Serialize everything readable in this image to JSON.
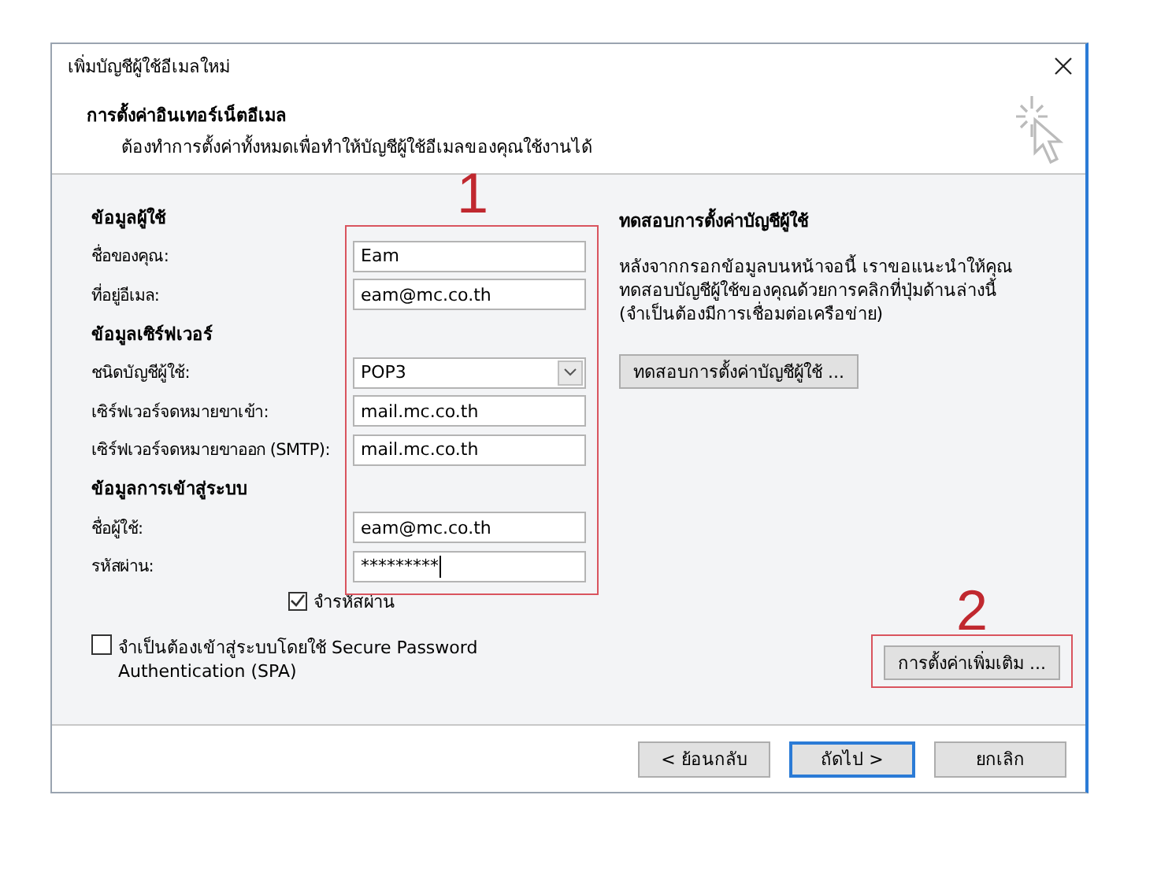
{
  "window": {
    "title": "เพิ่มบัญชีผู้ใช้อีเมลใหม่"
  },
  "header": {
    "title": "การตั้งค่าอินเทอร์เน็ตอีเมล",
    "subtitle": "ต้องทำการตั้งค่าทั้งหมดเพื่อทำให้บัญชีผู้ใช้อีเมลของคุณใช้งานได้"
  },
  "sections": [
    {
      "heading": "ข้อมูลผู้ใช้",
      "fields": [
        {
          "label": "ชื่อของคุณ:",
          "value": "Eam",
          "kind": "text"
        },
        {
          "label": "ที่อยู่อีเมล:",
          "value": "eam@mc.co.th",
          "kind": "text"
        }
      ]
    },
    {
      "heading": "ข้อมูลเซิร์ฟเวอร์",
      "fields": [
        {
          "label": "ชนิดบัญชีผู้ใช้:",
          "value": "POP3",
          "kind": "dropdown"
        },
        {
          "label": "เซิร์ฟเวอร์จดหมายขาเข้า:",
          "value": "mail.mc.co.th",
          "kind": "text"
        },
        {
          "label": "เซิร์ฟเวอร์จดหมายขาออก (SMTP):",
          "value": "mail.mc.co.th",
          "kind": "text"
        }
      ]
    },
    {
      "heading": "ข้อมูลการเข้าสู่ระบบ",
      "fields": [
        {
          "label": "ชื่อผู้ใช้:",
          "value": "eam@mc.co.th",
          "kind": "text"
        },
        {
          "label": "รหัสผ่าน:",
          "value": "*********",
          "kind": "password"
        }
      ]
    }
  ],
  "remember_password": {
    "label": "จำรหัสผ่าน",
    "checked": true
  },
  "spa": {
    "label": "จำเป็นต้องเข้าสู่ระบบโดยใช้ Secure Password Authentication (SPA)",
    "checked": false
  },
  "test": {
    "heading": "ทดสอบการตั้งค่าบัญชีผู้ใช้",
    "description": "หลังจากกรอกข้อมูลบนหน้าจอนี้ เราขอแนะนำให้คุณทดสอบบัญชีผู้ใช้ของคุณด้วยการคลิกที่ปุ่มด้านล่างนี้ (จำเป็นต้องมีการเชื่อมต่อเครือข่าย)",
    "button": "ทดสอบการตั้งค่าบัญชีผู้ใช้ ..."
  },
  "more_settings_button": "การตั้งค่าเพิ่มเติม ...",
  "footer_buttons": [
    {
      "label": "< ย้อนกลับ",
      "default": false
    },
    {
      "label": "ถัดไป >",
      "default": true
    },
    {
      "label": "ยกเลิก",
      "default": false
    }
  ],
  "annotations": [
    {
      "label": "1"
    },
    {
      "label": "2"
    }
  ]
}
